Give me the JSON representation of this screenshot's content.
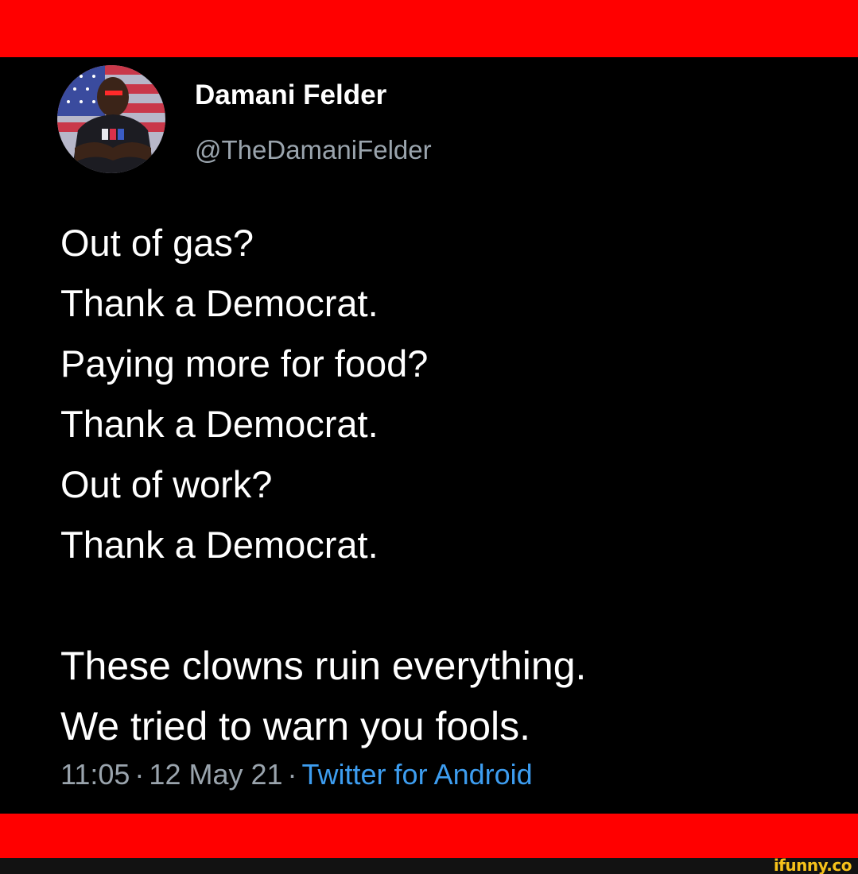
{
  "header": {
    "display_name": "Damani Felder",
    "handle": "@TheDamaniFelder",
    "avatar_icon": "profile-avatar-icon"
  },
  "tweet": {
    "lines": [
      "Out of gas?",
      "Thank a Democrat.",
      "Paying more for food?",
      "Thank a Democrat.",
      "Out of work?",
      "Thank a Democrat.",
      "",
      "These clowns ruin everything.",
      "We tried to warn you fools."
    ]
  },
  "meta": {
    "time": "11:05",
    "separator": "·",
    "date": "12 May 21",
    "source": "Twitter for Android"
  },
  "watermark": {
    "text": "ifunny.co"
  },
  "colors": {
    "banner": "#ff0000",
    "background": "#000000",
    "text": "#ffffff",
    "muted": "#9aa4ad",
    "link": "#3d9df0",
    "watermark": "#f6c21a"
  }
}
